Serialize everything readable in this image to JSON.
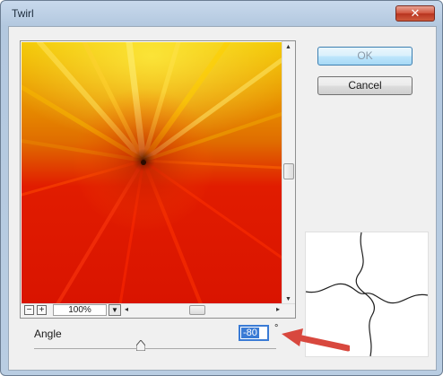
{
  "window": {
    "title": "Twirl",
    "close_label": "✕"
  },
  "buttons": {
    "ok": "OK",
    "cancel": "Cancel"
  },
  "preview": {
    "zoom_minus": "−",
    "zoom_plus": "+",
    "zoom_value": "100%"
  },
  "angle": {
    "label": "Angle",
    "value": "-80",
    "unit": "°",
    "slider_fraction": 0.44
  },
  "colors": {
    "annotation_arrow": "#d8483e",
    "field_highlight": "#3a7bd5"
  }
}
